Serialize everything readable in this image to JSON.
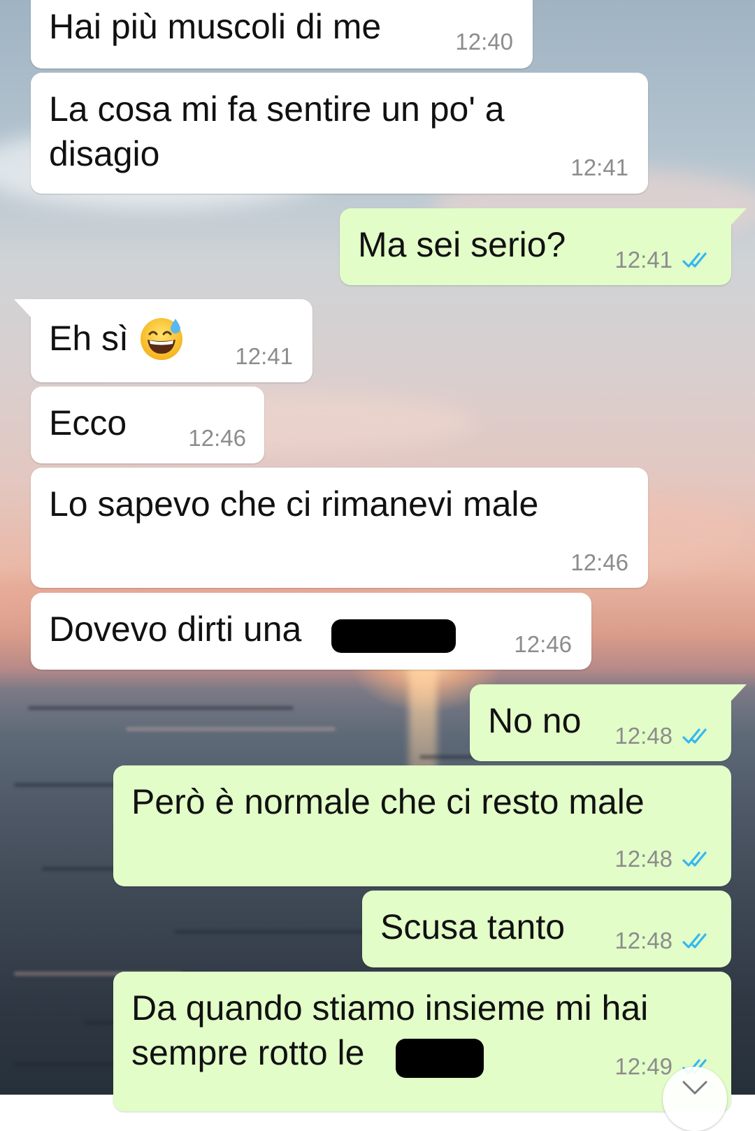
{
  "messages": [
    {
      "direction": "incoming",
      "text": "Hai più muscoli di me",
      "time": "12:40"
    },
    {
      "direction": "incoming",
      "text": "La cosa mi fa sentire un po' a\ndisagio",
      "time": "12:41"
    },
    {
      "direction": "outgoing",
      "text": "Ma sei serio?",
      "time": "12:41",
      "status": "read"
    },
    {
      "direction": "incoming",
      "text": "Eh sì",
      "emoji": "grinning-face-with-sweat",
      "time": "12:41"
    },
    {
      "direction": "incoming",
      "text": "Ecco",
      "time": "12:46"
    },
    {
      "direction": "incoming",
      "text": "Lo sapevo che ci rimanevi male",
      "time": "12:46"
    },
    {
      "direction": "incoming",
      "text": "Dovevo dirti una",
      "time": "12:46",
      "redacted": true
    },
    {
      "direction": "outgoing",
      "text": "No no",
      "time": "12:48",
      "status": "read"
    },
    {
      "direction": "outgoing",
      "text": "Però è normale che ci resto male",
      "time": "12:48",
      "status": "read"
    },
    {
      "direction": "outgoing",
      "text": "Scusa tanto",
      "time": "12:48",
      "status": "read"
    },
    {
      "direction": "outgoing",
      "text": "Da quando stiamo insieme mi hai\nsempre rotto le",
      "time": "12:49",
      "status": "read",
      "redacted": true
    }
  ],
  "icons": {
    "read_receipt": "double-check-icon",
    "scroll_down": "chevron-down-icon"
  },
  "colors": {
    "incoming_bubble": "#ffffff",
    "outgoing_bubble": "#e2fdc8",
    "read_ticks": "#34b7f1",
    "timestamp": "#8c8c8c",
    "redaction": "#000000"
  }
}
